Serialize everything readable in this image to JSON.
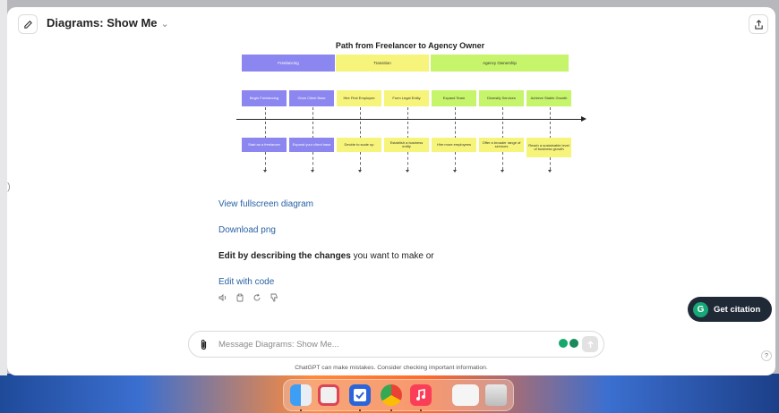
{
  "header": {
    "title": "Diagrams: Show Me",
    "chevron": "⌄"
  },
  "diagram": {
    "title": "Path from Freelancer to Agency Owner",
    "phases": [
      "Freelancing",
      "Transition",
      "Agency Ownership"
    ],
    "top_nodes": [
      "Begin Freelancing",
      "Grow Client Base",
      "Hire First Employee",
      "Form Legal Entity",
      "Expand Team",
      "Diversify Services",
      "Achieve Stable Growth"
    ],
    "bottom_nodes": [
      "Start as a freelancer",
      "Expand your client base",
      "Decide to scale up",
      "Establish a business entity",
      "Hire more employees",
      "Offer a broader range of services",
      "Reach a sustainable level of business growth"
    ]
  },
  "links": {
    "fullscreen": "View fullscreen diagram",
    "download": "Download png",
    "edit_code": "Edit with code"
  },
  "edit_prompt": {
    "bold": "Edit by describing the changes",
    "rest": " you want to make or"
  },
  "citation": {
    "logo": "G",
    "label": "Get citation"
  },
  "composer": {
    "placeholder": "Message Diagrams: Show Me..."
  },
  "disclaimer": "ChatGPT can make mistakes. Consider checking important information.",
  "help": "?",
  "sidebar_toggle": ")",
  "colors": {
    "purple": "#8c86f0",
    "yellow": "#f6f47a",
    "green": "#c6f46a",
    "link": "#2962a5",
    "citation_bg": "#1f2a36"
  },
  "dock_apps": [
    "Finder",
    "Launchpad",
    "Reminders",
    "Chrome",
    "Music",
    "Preview",
    "Trash"
  ]
}
